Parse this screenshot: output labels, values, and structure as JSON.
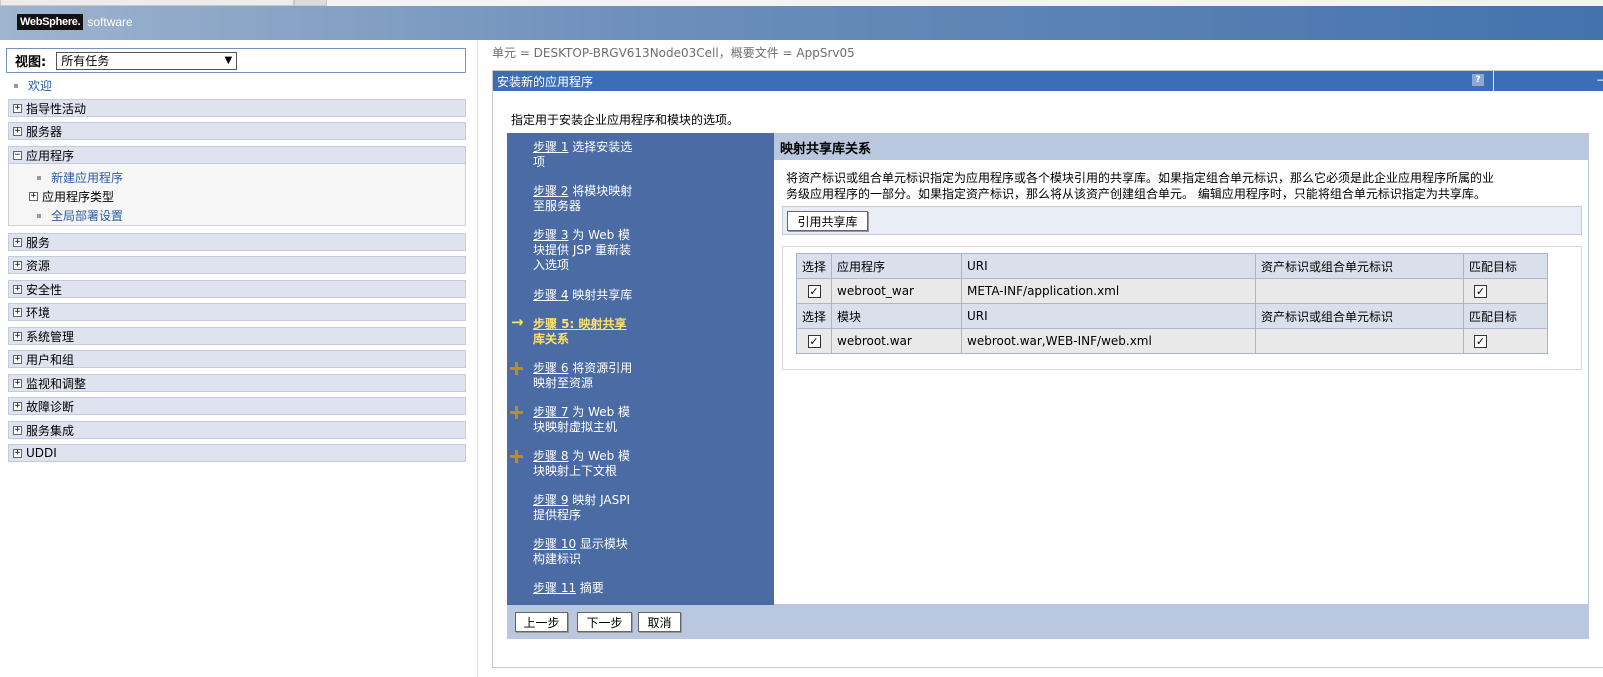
{
  "header": {
    "logo_brand": "WebSphere.",
    "logo_suffix": "software"
  },
  "nav": {
    "view_label": "视图:",
    "view_selected": "所有任务",
    "welcome": "欢迎",
    "sections": [
      {
        "label": "指导性活动",
        "state": "+"
      },
      {
        "label": "服务器",
        "state": "+"
      },
      {
        "label": "应用程序",
        "state": "−"
      },
      {
        "label": "服务",
        "state": "+"
      },
      {
        "label": "资源",
        "state": "+"
      },
      {
        "label": "安全性",
        "state": "+"
      },
      {
        "label": "环境",
        "state": "+"
      },
      {
        "label": "系统管理",
        "state": "+"
      },
      {
        "label": "用户和组",
        "state": "+"
      },
      {
        "label": "监视和调整",
        "state": "+"
      },
      {
        "label": "故障诊断",
        "state": "+"
      },
      {
        "label": "服务集成",
        "state": "+"
      },
      {
        "label": "UDDI",
        "state": "+"
      }
    ],
    "app_children": {
      "new_app": "新建应用程序",
      "app_types": "应用程序类型",
      "global_deploy": "全局部署设置"
    }
  },
  "main": {
    "breadcrumb": "单元 = DESKTOP-BRGV613Node03Cell，概要文件 = AppSrv05",
    "title": "安装新的应用程序",
    "help_glyph": "?",
    "minimize_glyph": "−",
    "intro": "指定用于安装企业应用程序和模块的选项。",
    "steps": [
      {
        "link": "步骤 1",
        "rest": " 选择安装选",
        "rest2": "项",
        "marker": "none"
      },
      {
        "link": "步骤 2",
        "rest": " 将模块映射",
        "rest2": "至服务器",
        "marker": "none"
      },
      {
        "link": "步骤 3",
        "rest": " 为 Web 模",
        "rest2": "块提供 JSP 重新装",
        "rest3": "入选项",
        "marker": "none"
      },
      {
        "link": "步骤 4",
        "rest": " 映射共享库",
        "marker": "none"
      },
      {
        "link": "步骤 5: 映射共享",
        "rest2": "库关系",
        "marker": "arrow"
      },
      {
        "link": "步骤 6",
        "rest": " 将资源引用",
        "rest2": "映射至资源",
        "marker": "cross"
      },
      {
        "link": "步骤 7",
        "rest": " 为 Web 模",
        "rest2": "块映射虚拟主机",
        "marker": "cross"
      },
      {
        "link": "步骤 8",
        "rest": " 为 Web 模",
        "rest2": "块映射上下文根",
        "marker": "cross"
      },
      {
        "link": "步骤 9",
        "rest": " 映射 JASPI",
        "rest2": "提供程序",
        "marker": "none"
      },
      {
        "link": "步骤 10",
        "rest": " 显示模块",
        "rest2": "构建标识",
        "marker": "none"
      },
      {
        "link": "步骤 11",
        "rest": " 摘要",
        "marker": "none"
      }
    ],
    "section_title": "映射共享库关系",
    "description_line1": "将资产标识或组合单元标识指定为应用程序或各个模块引用的共享库。如果指定组合单元标识，那么它必须是此企业应用程序所属的业",
    "description_line2": "务级应用程序的一部分。如果指定资产标识，那么将从该资产创建组合单元。 编辑应用程序时，只能将组合单元标识指定为共享库。",
    "ref_lib_button": "引用共享库",
    "table": {
      "app_header": [
        "选择",
        "应用程序",
        "URI",
        "资产标识或组合单元标识",
        "匹配目标"
      ],
      "app_row": {
        "checked": "✓",
        "name": "webroot_war",
        "uri": "META-INF/application.xml",
        "asset": "",
        "match": "✓"
      },
      "mod_header": [
        "选择",
        "模块",
        "URI",
        "资产标识或组合单元标识",
        "匹配目标"
      ],
      "mod_row": {
        "checked": "✓",
        "name": "webroot.war",
        "uri": "webroot.war,WEB-INF/web.xml",
        "asset": "",
        "match": "✓"
      }
    },
    "buttons": {
      "prev": "上一步",
      "next": "下一步",
      "cancel": "取消"
    }
  }
}
